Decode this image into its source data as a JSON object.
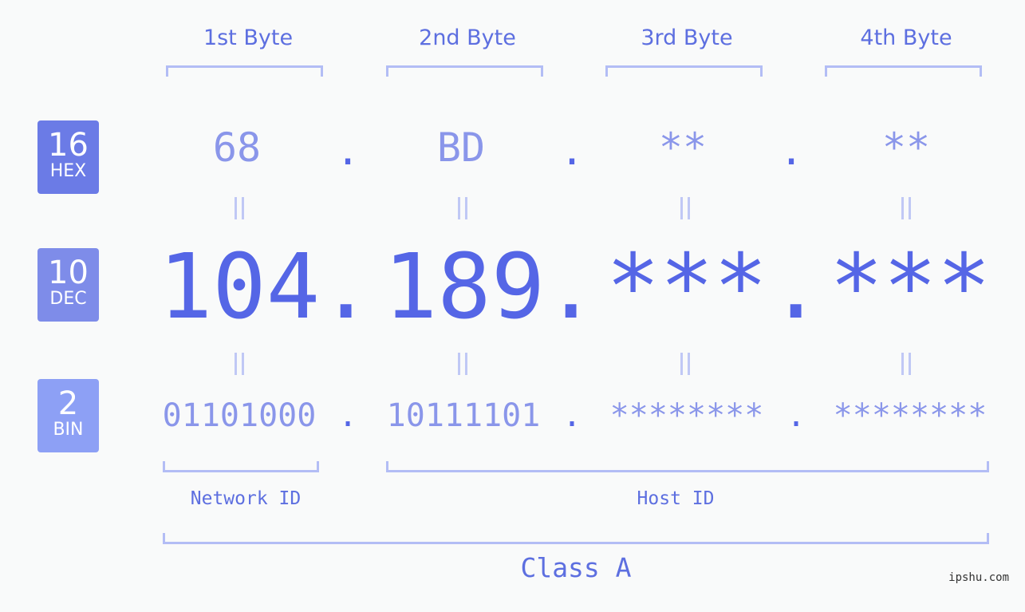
{
  "bytes": [
    {
      "header": "1st Byte",
      "hex": "68",
      "dec": "104",
      "bin": "01101000"
    },
    {
      "header": "2nd Byte",
      "hex": "BD",
      "dec": "189",
      "bin": "10111101"
    },
    {
      "header": "3rd Byte",
      "hex": "**",
      "dec": "***",
      "bin": "********"
    },
    {
      "header": "4th Byte",
      "hex": "**",
      "dec": "***",
      "bin": "********"
    }
  ],
  "separator": ".",
  "badges": {
    "hex": {
      "num": "16",
      "label": "HEX",
      "color": "#6b7be6"
    },
    "dec": {
      "num": "10",
      "label": "DEC",
      "color": "#7e8ce9"
    },
    "bin": {
      "num": "2",
      "label": "BIN",
      "color": "#8da0f5"
    }
  },
  "labels": {
    "network_id": "Network ID",
    "host_id": "Host ID",
    "class": "Class A"
  },
  "watermark": "ipshu.com",
  "colors": {
    "accent": "#5566e6",
    "light": "#8a96ea",
    "bracket": "#b3bdf5",
    "background": "#f9fafa"
  }
}
